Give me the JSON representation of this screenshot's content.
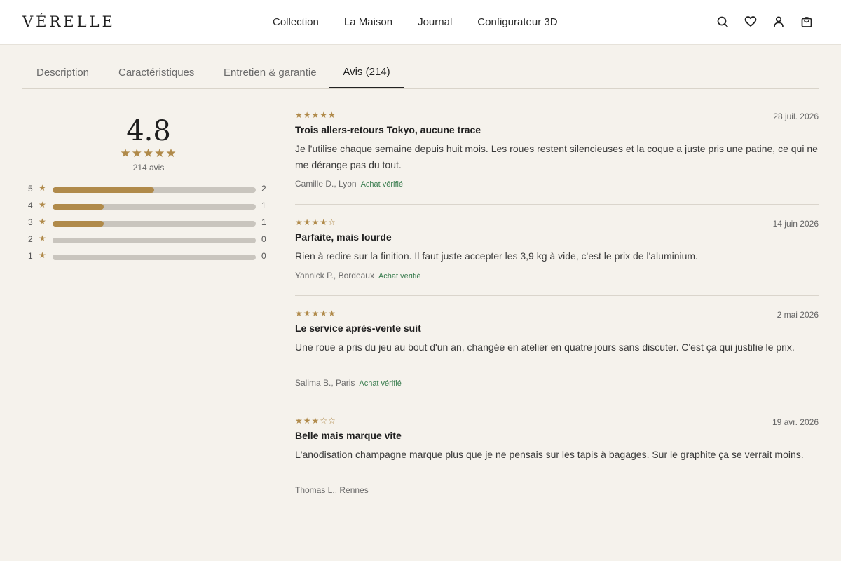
{
  "header": {
    "logo": "VÉRELLE",
    "nav": [
      "Collection",
      "La Maison",
      "Journal",
      "Configurateur 3D"
    ],
    "icons": [
      "search-icon",
      "heart-icon",
      "user-icon",
      "bag-icon"
    ]
  },
  "tabs": [
    {
      "label": "Description",
      "active": false
    },
    {
      "label": "Caractéristiques",
      "active": false
    },
    {
      "label": "Entretien & garantie",
      "active": false
    },
    {
      "label": "Avis (214)",
      "active": true
    }
  ],
  "summary": {
    "average": "4.8",
    "stars": "★★★★★",
    "count_label": "214 avis",
    "distribution": [
      {
        "stars": "5",
        "count": "2",
        "fraction": 0.5
      },
      {
        "stars": "4",
        "count": "1",
        "fraction": 0.25
      },
      {
        "stars": "3",
        "count": "1",
        "fraction": 0.25
      },
      {
        "stars": "2",
        "count": "0",
        "fraction": 0
      },
      {
        "stars": "1",
        "count": "0",
        "fraction": 0
      }
    ]
  },
  "reviews": [
    {
      "rating": 5,
      "stars": "★★★★★",
      "date": "28 juil. 2026",
      "title": "Trois allers-retours Tokyo, aucune trace",
      "body": "Je l'utilise chaque semaine depuis huit mois. Les roues restent silencieuses et la coque a juste pris une patine, ce qui ne me dérange pas du tout.",
      "author": "Camille D., Lyon",
      "verified": "Achat vérifié"
    },
    {
      "rating": 4,
      "stars": "★★★★☆",
      "date": "14 juin 2026",
      "title": "Parfaite, mais lourde",
      "body": "Rien à redire sur la finition. Il faut juste accepter les 3,9 kg à vide, c'est le prix de l'aluminium.",
      "author": "Yannick P., Bordeaux",
      "verified": "Achat vérifié"
    },
    {
      "rating": 5,
      "stars": "★★★★★",
      "date": "2 mai 2026",
      "title": "Le service après-vente suit",
      "body": "Une roue a pris du jeu au bout d'un an, changée en atelier en quatre jours sans discuter. C'est ça qui justifie le prix.",
      "author": "Salima B., Paris",
      "verified": "Achat vérifié"
    },
    {
      "rating": 3,
      "stars": "★★★☆☆",
      "date": "19 avr. 2026",
      "title": "Belle mais marque vite",
      "body": "L'anodisation champagne marque plus que je ne pensais sur les tapis à bagages. Sur le graphite ça se verrait moins.",
      "author": "Thomas L., Rennes",
      "verified": ""
    }
  ],
  "colors": {
    "accent": "#b08a4a",
    "verified": "#3a7d4f",
    "background": "#f5f2ec"
  }
}
